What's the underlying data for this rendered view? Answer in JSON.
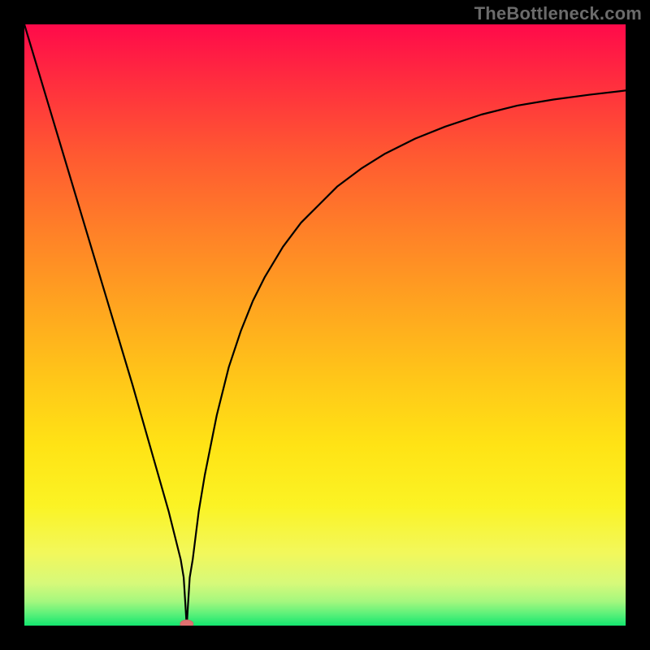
{
  "watermark": {
    "text": "TheBottleneck.com"
  },
  "chart_data": {
    "type": "line",
    "title": "",
    "xlabel": "",
    "ylabel": "",
    "xlim": [
      0,
      100
    ],
    "ylim": [
      0,
      100
    ],
    "grid": false,
    "legend": false,
    "marker": {
      "present": true,
      "x": 27,
      "y": 0,
      "color": "#e07070"
    },
    "series": [
      {
        "name": "curve",
        "x": [
          0,
          3,
          6,
          9,
          12,
          15,
          18,
          20,
          22,
          24,
          25,
          26,
          26.5,
          27,
          27.5,
          28,
          28.5,
          29,
          30,
          32,
          34,
          36,
          38,
          40,
          43,
          46,
          49,
          52,
          56,
          60,
          65,
          70,
          76,
          82,
          88,
          94,
          100
        ],
        "y": [
          100,
          90,
          80,
          70,
          60,
          50,
          40,
          33,
          26,
          19,
          15,
          11,
          8,
          0,
          8,
          11,
          15,
          19,
          25,
          35,
          43,
          49,
          54,
          58,
          63,
          67,
          70,
          73,
          76,
          78.5,
          81,
          83,
          85,
          86.5,
          87.5,
          88.3,
          89
        ]
      }
    ]
  }
}
